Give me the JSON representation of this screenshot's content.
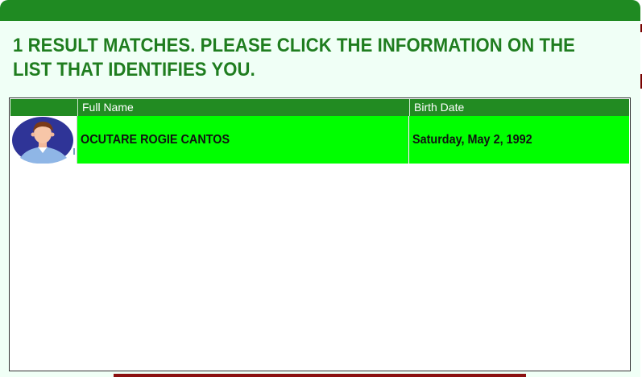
{
  "headline": "1 RESULT MATCHES. PLEASE CLICK THE INFORMATION ON THE LIST THAT IDENTIFIES YOU.",
  "table": {
    "columns": {
      "photo": "",
      "full_name": "Full Name",
      "birth_date": "Birth Date"
    },
    "rows": [
      {
        "avatar": "user-avatar-icon",
        "full_name": "OCUTARE ROGIE CANTOS",
        "birth_date": "Saturday, May 2, 1992"
      }
    ]
  },
  "colors": {
    "header_green": "#1f8a22",
    "headline_text": "#1f7d1f",
    "row_highlight": "#00ff00",
    "dialog_bg": "#f0fff6",
    "accent_dark_red": "#8b1010"
  }
}
